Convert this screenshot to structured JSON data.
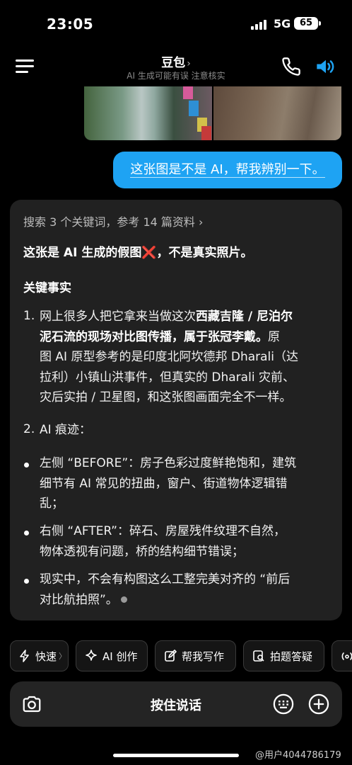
{
  "status_bar": {
    "time": "23:05",
    "network": "5G",
    "battery": "65"
  },
  "header": {
    "title": "豆包",
    "title_chevron": "›",
    "subtitle": "AI 生成可能有误 注意核实",
    "icons": [
      "menu-icon",
      "phone-icon",
      "speaker-icon"
    ],
    "accent_color": "#1ea3f3"
  },
  "conversation": {
    "user_message": "这张图是不是 AI，帮我辨别一下。",
    "answer": {
      "search_meta": "搜索 3 个关键词，参考 14 篇资料 ›",
      "headline_pre": "这张是 AI 生成的假图",
      "headline_mark": "❌",
      "headline_post": "，不是真实照片。",
      "section_title": "关键事实",
      "item1_num": "1.",
      "item1_l1a": "网上很多人把它拿来当做这次",
      "item1_l1b": "西藏吉隆 / 尼泊尔",
      "item1_l2a": "泥石流的现场对比图传播，属于张冠李戴。",
      "item1_l2b": "原",
      "item1_l3": "图 AI 原型参考的是印度北阿坎德邦 Dharali（达",
      "item1_l4": "拉利）小镇山洪事件，但真实的 Dharali 灾前、",
      "item1_l5": "灾后实拍 / 卫星图，和这张图画面完全不一样。",
      "item2_num": "2.",
      "item2_text": "AI 痕迹：",
      "bullet1_l1": "左侧 “BEFORE”：房子色彩过度鲜艳饱和，建筑",
      "bullet1_l2": "细节有 AI 常见的扭曲，窗户、街道物体逻辑错",
      "bullet1_l3": "乱；",
      "bullet2_l1": "右侧 “AFTER”：碎石、房屋残件纹理不自然，",
      "bullet2_l2": "物体透视有问题，桥的结构细节错误；",
      "bullet3_l1": "现实中，不会有构图这么工整完美对齐的 “前后",
      "bullet3_l2": "对比航拍照”。"
    }
  },
  "chips": [
    {
      "label": "快速",
      "icon": "lightning-icon",
      "chevron": "〉"
    },
    {
      "label": "AI 创作",
      "icon": "sparkle-icon"
    },
    {
      "label": "帮我写作",
      "icon": "edit-icon"
    },
    {
      "label": "拍题答疑",
      "icon": "scan-question-icon"
    }
  ],
  "input_bar": {
    "hold_to_talk": "按住说话",
    "icons": [
      "camera-icon",
      "keyboard-icon",
      "plus-icon"
    ]
  },
  "watermark": "@用户4044786179"
}
